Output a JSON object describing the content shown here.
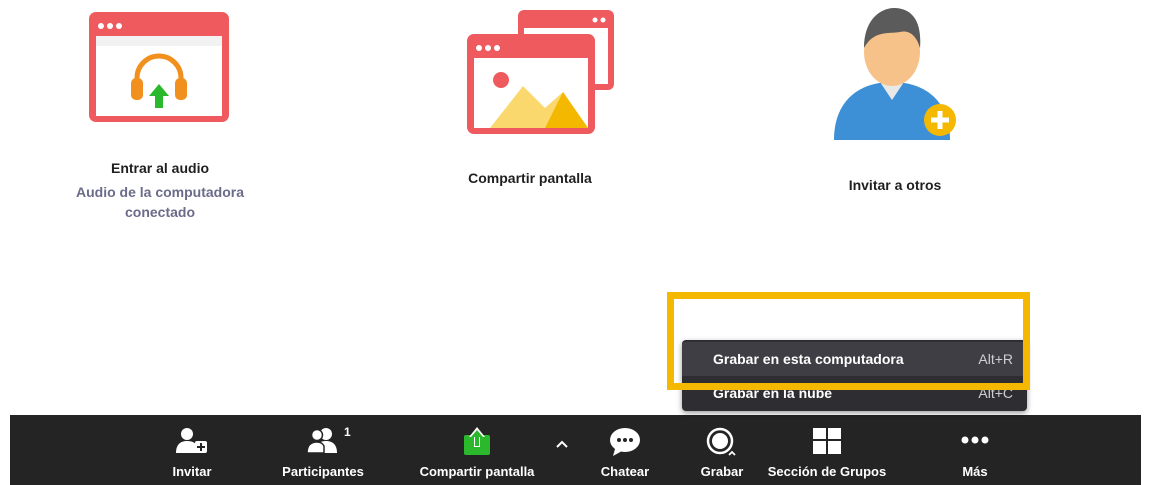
{
  "tiles": {
    "audio": {
      "title": "Entrar al audio",
      "subtitle_line1": "Audio de la computadora",
      "subtitle_line2": "conectado"
    },
    "share": {
      "title": "Compartir pantalla"
    },
    "invite": {
      "title": "Invitar a otros"
    }
  },
  "record_menu": {
    "items": [
      {
        "label": "Grabar en esta computadora",
        "shortcut": "Alt+R"
      },
      {
        "label": "Grabar en la nube",
        "shortcut": "Alt+C"
      }
    ]
  },
  "toolbar": {
    "invite": "Invitar",
    "participants": "Participantes",
    "participants_count": "1",
    "share": "Compartir pantalla",
    "chat": "Chatear",
    "record": "Grabar",
    "breakout": "Sección de Grupos",
    "more": "Más"
  },
  "colors": {
    "window_red": "#ef5a5f",
    "highlight": "#f5b800",
    "toolbar_bg": "#242424",
    "share_green": "#2cb82c"
  }
}
